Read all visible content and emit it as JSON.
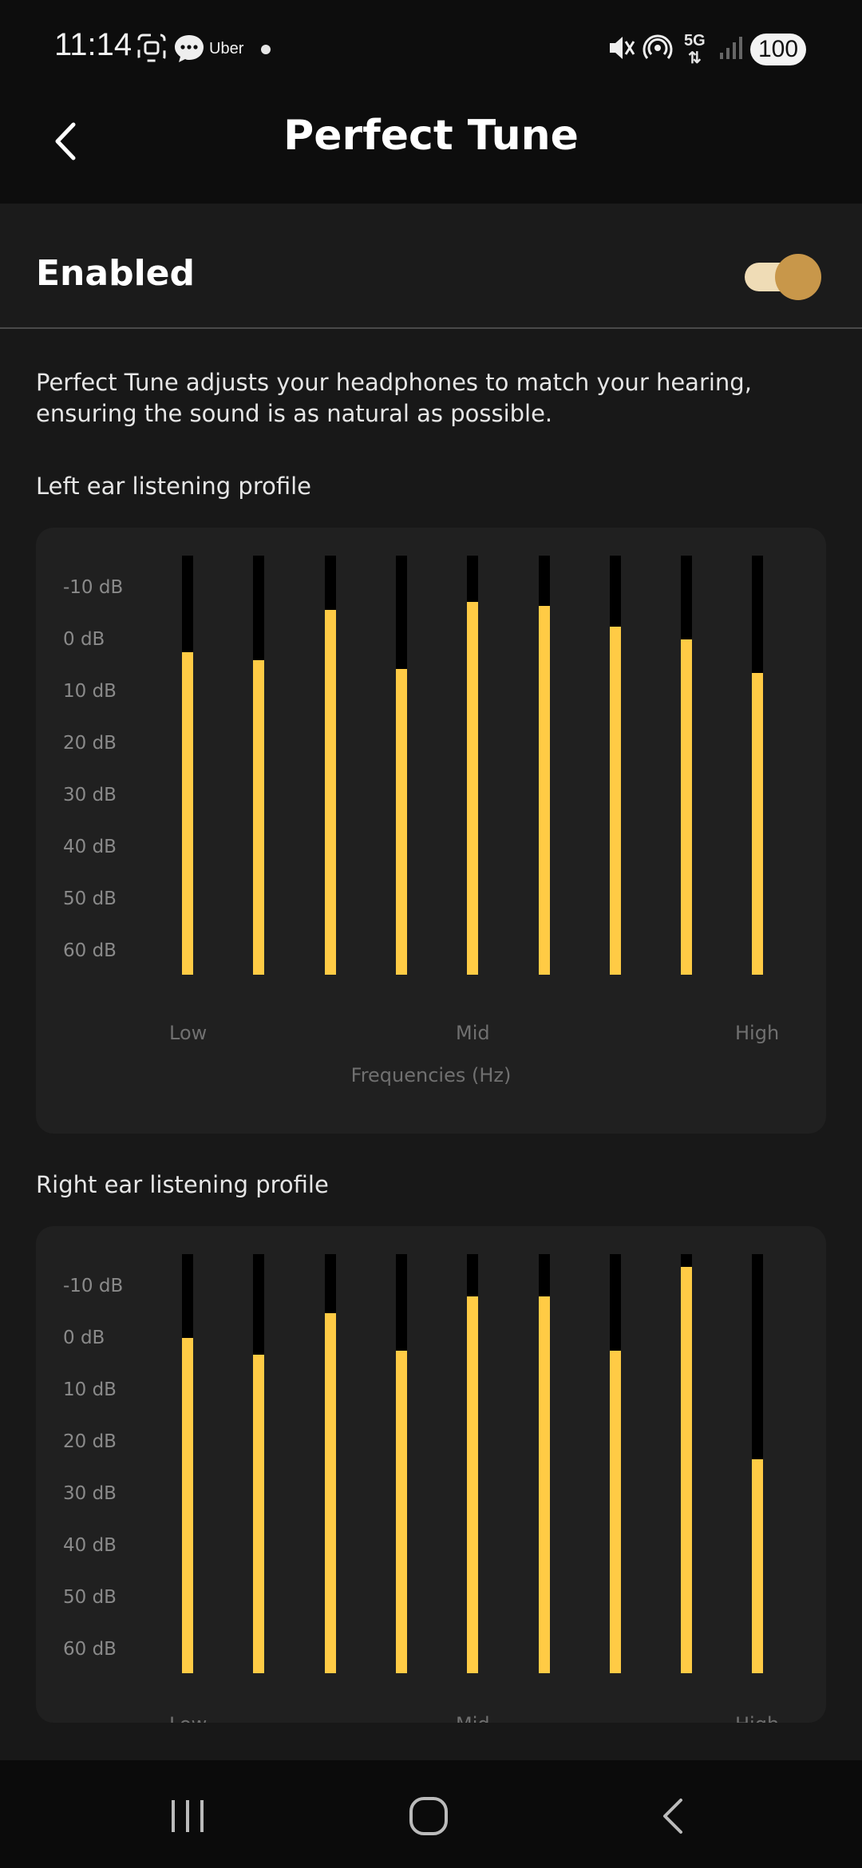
{
  "status": {
    "time": "11:14",
    "app_label": "Uber",
    "network": "5G",
    "battery": "100"
  },
  "header": {
    "title": "Perfect Tune"
  },
  "enabled": {
    "label": "Enabled",
    "on": true
  },
  "description": "Perfect Tune adjusts your headphones to match your hearing, ensuring the sound is as natural as possible.",
  "left": {
    "title": "Left ear listening profile",
    "y_labels": [
      "-10 dB",
      "0 dB",
      "10 dB",
      "20 dB",
      "30 dB",
      "40 dB",
      "50 dB",
      "60 dB"
    ],
    "x_labels": [
      "Low",
      "Mid",
      "High"
    ],
    "x_title": "Frequencies (Hz)",
    "levels": [
      0.77,
      0.75,
      0.87,
      0.73,
      0.89,
      0.88,
      0.83,
      0.8,
      0.72
    ]
  },
  "right": {
    "title": "Right ear listening profile",
    "y_labels": [
      "-10 dB",
      "0 dB",
      "10 dB",
      "20 dB",
      "30 dB",
      "40 dB",
      "50 dB",
      "60 dB"
    ],
    "x_labels": [
      "Low",
      "Mid",
      "High"
    ],
    "levels": [
      0.8,
      0.76,
      0.86,
      0.77,
      0.9,
      0.9,
      0.77,
      0.97,
      0.51
    ]
  },
  "colors": {
    "accent": "#ffcb45",
    "toggle_knob": "#c8974a",
    "toggle_track": "#efdcb6"
  }
}
